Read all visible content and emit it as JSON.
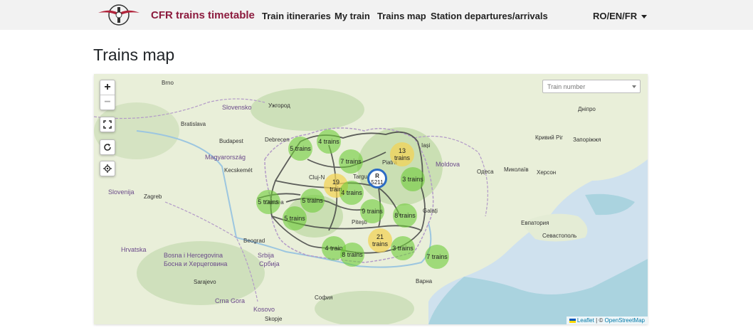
{
  "nav": {
    "brand": "CFR trains timetable",
    "links": [
      {
        "label": "Train itineraries"
      },
      {
        "label": "My train"
      },
      {
        "label": "Trains map"
      },
      {
        "label": "Station departures/arrivals"
      }
    ],
    "language": "RO/EN/FR"
  },
  "page": {
    "title": "Trains map"
  },
  "map": {
    "controls": {
      "zoom_in": "+",
      "zoom_out": "−"
    },
    "train_number": {
      "placeholder": "Train number"
    },
    "train_marker": {
      "type": "R",
      "number": "5211"
    },
    "attribution": {
      "leaflet": "Leaflet",
      "sep": "| ©",
      "osm": "OpenStreetMap"
    },
    "clusters": [
      {
        "count": "5",
        "unit": "trains"
      },
      {
        "count": "4",
        "unit": "trains"
      },
      {
        "count": "7",
        "unit": "trains"
      },
      {
        "count": "13",
        "unit": "trains"
      },
      {
        "count": "3",
        "unit": "trains"
      },
      {
        "count": "19",
        "unit": "train"
      },
      {
        "count": "4",
        "unit": "trains"
      },
      {
        "count": "5",
        "unit": "trains"
      },
      {
        "count": "5",
        "unit": "trains"
      },
      {
        "count": "9",
        "unit": "trains"
      },
      {
        "count": "8",
        "unit": "trains"
      },
      {
        "count": "5",
        "unit": "trains"
      },
      {
        "count": "21",
        "unit": "trains"
      },
      {
        "count": "4",
        "unit": "train"
      },
      {
        "count": "8",
        "unit": "trains"
      },
      {
        "count": "3",
        "unit": "trains"
      },
      {
        "count": "7",
        "unit": "trains"
      }
    ],
    "places": [
      {
        "name": "Brno"
      },
      {
        "name": "Bratislava"
      },
      {
        "name": "Budapest"
      },
      {
        "name": "Magyarország"
      },
      {
        "name": "Kecskemét"
      },
      {
        "name": "Slovensko"
      },
      {
        "name": "Cluj-N"
      },
      {
        "name": "Moldova"
      },
      {
        "name": "Кривий Ріг"
      },
      {
        "name": "Запоріжжя"
      },
      {
        "name": "Дніпро"
      },
      {
        "name": "Миколаїв"
      },
      {
        "name": "Одеса"
      },
      {
        "name": "Херсон"
      },
      {
        "name": "Севастополь"
      },
      {
        "name": "Евпатория"
      },
      {
        "name": "Srbija"
      },
      {
        "name": "Hrvatska"
      },
      {
        "name": "Slovenija"
      },
      {
        "name": "Zagreb"
      },
      {
        "name": "Beograd"
      },
      {
        "name": "Србија"
      },
      {
        "name": "Bosna i Hercegovina"
      },
      {
        "name": "Босна и Херцеговина"
      },
      {
        "name": "Sarajevo"
      },
      {
        "name": "Crna Gora"
      },
      {
        "name": "Kosovo"
      },
      {
        "name": "Skopje"
      },
      {
        "name": "София"
      },
      {
        "name": "Варна"
      },
      {
        "name": "Galați"
      },
      {
        "name": "Ужгород"
      },
      {
        "name": "Debrecen"
      },
      {
        "name": "Oradea"
      },
      {
        "name": "Targu"
      },
      {
        "name": "Piatra"
      },
      {
        "name": "Iași"
      },
      {
        "name": "Pitești"
      }
    ]
  }
}
